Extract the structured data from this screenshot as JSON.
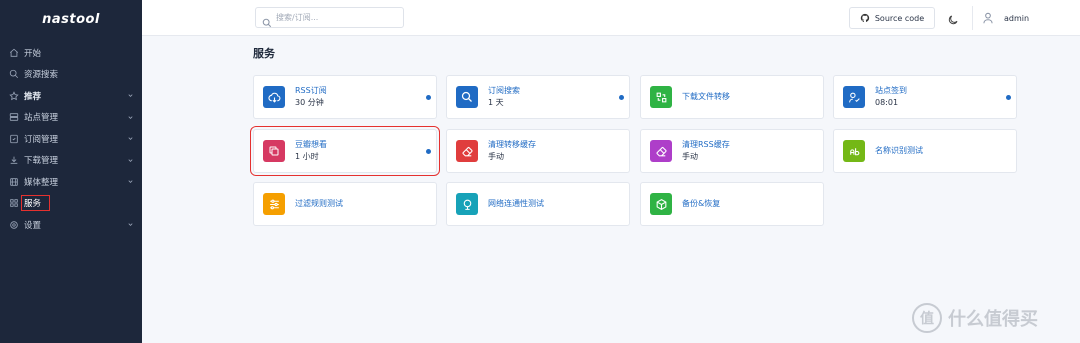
{
  "app": {
    "logo": "nastool"
  },
  "sidebar": {
    "items": [
      {
        "label": "开始",
        "icon": "home-icon"
      },
      {
        "label": "资源搜索",
        "icon": "search-icon"
      },
      {
        "label": "推荐",
        "icon": "star-icon"
      },
      {
        "label": "站点管理",
        "icon": "server-icon"
      },
      {
        "label": "订阅管理",
        "icon": "subscribe-icon"
      },
      {
        "label": "下载管理",
        "icon": "download-icon"
      },
      {
        "label": "媒体整理",
        "icon": "film-icon"
      },
      {
        "label": "服务",
        "icon": "apps-icon"
      },
      {
        "label": "设置",
        "icon": "gear-icon"
      }
    ]
  },
  "header": {
    "search": {
      "placeholder": "搜索/订阅..."
    },
    "source_code_label": "Source code",
    "user_name": "admin"
  },
  "main": {
    "title": "服务",
    "cards": [
      {
        "name": "RSS订阅",
        "sub": "30 分钟",
        "color": "#206bc4"
      },
      {
        "name": "订阅搜索",
        "sub": "1 天",
        "color": "#206bc4"
      },
      {
        "name": "下载文件转移",
        "sub": "",
        "color": "#2fb344"
      },
      {
        "name": "站点签到",
        "sub": "08:01",
        "color": "#206bc4"
      },
      {
        "name": "豆瓣想看",
        "sub": "1 小时",
        "color": "#d63939"
      },
      {
        "name": "清理转移缓存",
        "sub": "手动",
        "color": "#e03d3d"
      },
      {
        "name": "清理RSS缓存",
        "sub": "手动",
        "color": "#ae3ec9"
      },
      {
        "name": "名称识别测试",
        "sub": "",
        "color": "#74b816"
      },
      {
        "name": "过滤规则测试",
        "sub": "",
        "color": "#f59f00"
      },
      {
        "name": "网络连通性测试",
        "sub": "",
        "color": "#17a2b8"
      },
      {
        "name": "备份&恢复",
        "sub": "",
        "color": "#2fb344"
      }
    ]
  },
  "watermark": {
    "text": "什么值得买",
    "badge": "值"
  }
}
